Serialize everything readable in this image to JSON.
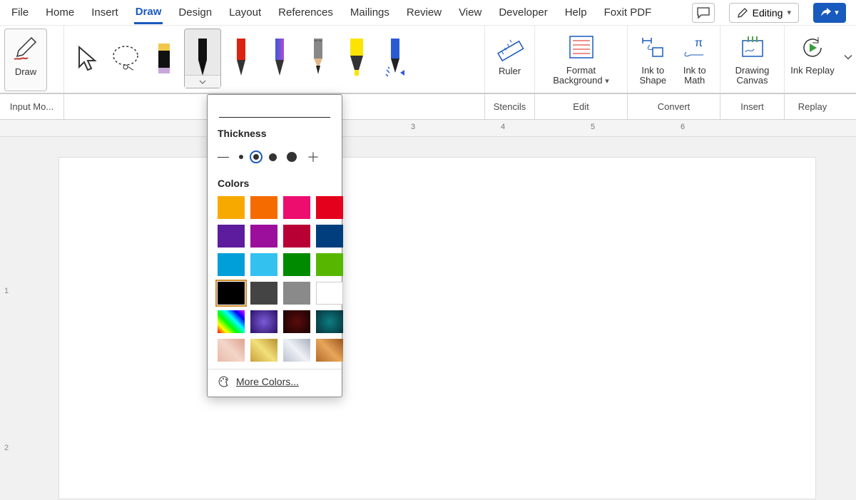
{
  "tabs": [
    "File",
    "Home",
    "Insert",
    "Draw",
    "Design",
    "Layout",
    "References",
    "Mailings",
    "Review",
    "View",
    "Developer",
    "Help",
    "Foxit PDF"
  ],
  "active_tab": "Draw",
  "editing_mode": "Editing",
  "ribbon": {
    "draw_btn": "Draw",
    "ruler": "Ruler",
    "format_bg": "Format Background",
    "ink_shape": "Ink to Shape",
    "ink_math": "Ink to Math",
    "drawing_canvas": "Drawing Canvas",
    "ink_replay": "Ink Replay"
  },
  "group_labels": {
    "input": "Input Mo...",
    "stencils": "Stencils",
    "edit": "Edit",
    "convert": "Convert",
    "insert": "Insert",
    "replay": "Replay"
  },
  "popup": {
    "thickness_label": "Thickness",
    "colors_label": "Colors",
    "more_colors": "More Colors...",
    "selected_thickness": 2,
    "selected_color": "#000000",
    "solid_colors": [
      "#f7a900",
      "#f56b00",
      "#ed0d6e",
      "#e4001c",
      "#5d1b9e",
      "#9c0f9c",
      "#b90035",
      "#003e7e",
      "#009fda",
      "#33c1f0",
      "#008a00",
      "#57b700",
      "#000000",
      "#444444",
      "#8a8a8a",
      "#ffffff"
    ],
    "texture_colors": [
      "rainbow",
      "galaxy",
      "lava",
      "ocean",
      "rose-gold",
      "gold",
      "silver",
      "bronze"
    ]
  },
  "ruler_numbers": [
    "3",
    "4",
    "5",
    "6"
  ]
}
